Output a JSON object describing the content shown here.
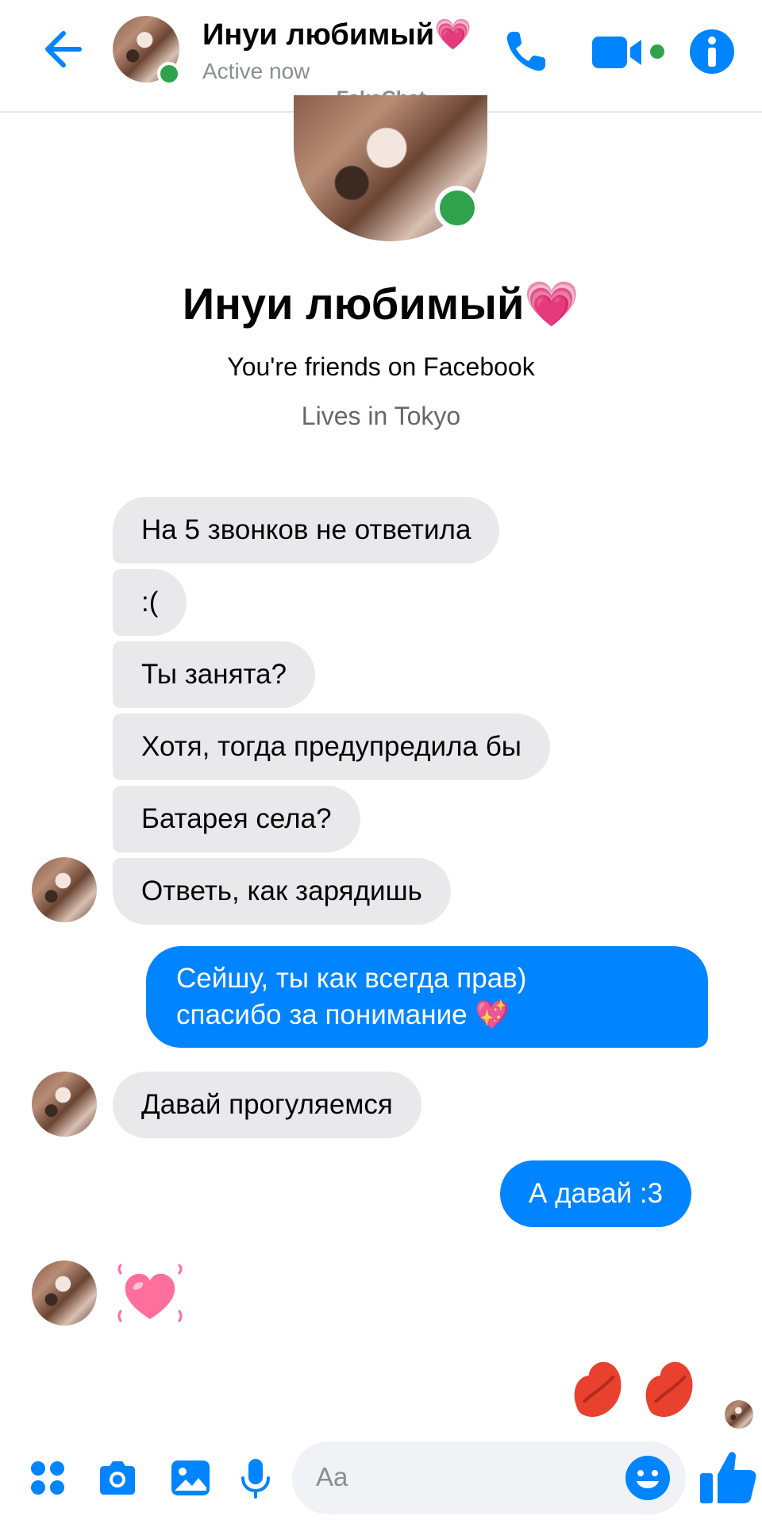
{
  "header": {
    "name": "Инуи любимый💗",
    "status": "Active now"
  },
  "watermark": "FakeChat",
  "profile": {
    "name": "Инуи любимый💗",
    "friends_text": "You're friends on Facebook",
    "lives_text": "Lives in Tokyo"
  },
  "messages": [
    {
      "from": "them",
      "text": "На 5 звонков не ответила"
    },
    {
      "from": "them",
      "text": ":("
    },
    {
      "from": "them",
      "text": "Ты занята?"
    },
    {
      "from": "them",
      "text": "Хотя, тогда предупредила бы"
    },
    {
      "from": "them",
      "text": "Батарея села?"
    },
    {
      "from": "them",
      "text": "Ответь, как зарядишь"
    },
    {
      "from": "me",
      "lines": [
        "Сейшу, ты как всегда прав)",
        "спасибо за понимание 💖"
      ]
    },
    {
      "from": "them",
      "text": "Давай прогуляемся"
    },
    {
      "from": "me",
      "text": "А давай :3"
    },
    {
      "from": "them",
      "emoji": "💗"
    },
    {
      "from": "me",
      "emoji": "💋💋"
    }
  ],
  "composer": {
    "placeholder": "Aa"
  },
  "colors": {
    "accent": "#0084ff",
    "incoming_bubble": "#e9e9eb",
    "online": "#31a24c",
    "kiss": "#e8412e",
    "heart": "#ff6f9c"
  }
}
